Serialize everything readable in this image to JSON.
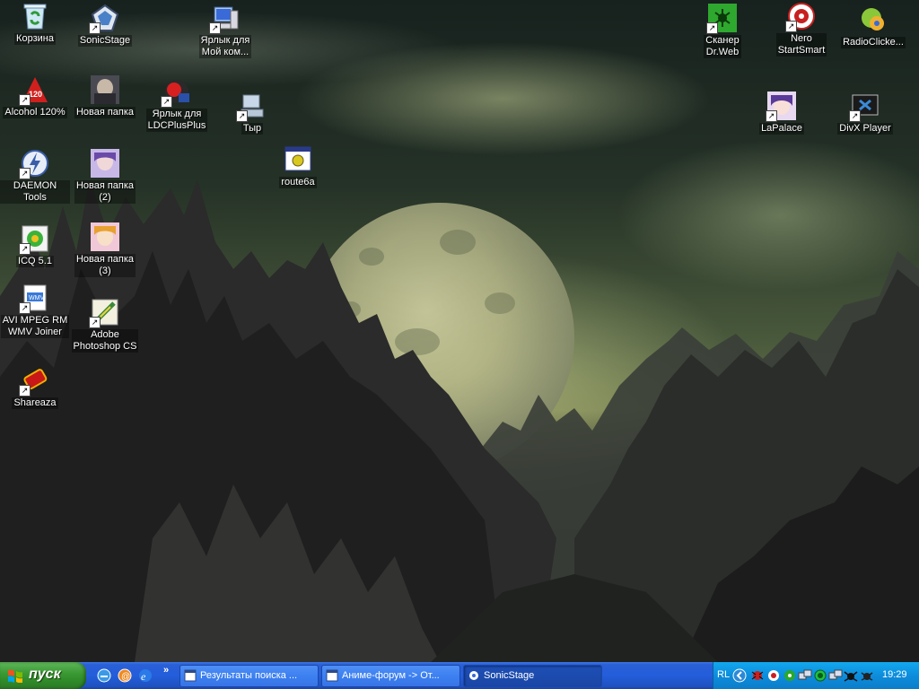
{
  "desktop": {
    "icons": [
      {
        "label": "Корзина",
        "name": "recycle-bin-icon"
      },
      {
        "label": "SonicStage",
        "name": "sonicstage-icon"
      },
      {
        "label": "Ярлык для\nМой ком...",
        "name": "my-computer-shortcut-icon"
      },
      {
        "label": "Сканер\nDr.Web",
        "name": "drweb-scanner-icon"
      },
      {
        "label": "Nero\nStartSmart",
        "name": "nero-icon"
      },
      {
        "label": "RadioClicke...",
        "name": "radioclicker-icon"
      },
      {
        "label": "Alcohol 120%",
        "name": "alcohol-icon"
      },
      {
        "label": "Новая папка",
        "name": "new-folder-icon"
      },
      {
        "label": "Ярлык для\nLDCPlusPlus",
        "name": "ldcplusplus-shortcut-icon"
      },
      {
        "label": "Тыр",
        "name": "tyr-icon"
      },
      {
        "label": "LaPalace",
        "name": "lapalace-icon"
      },
      {
        "label": "DivX Player",
        "name": "divx-player-icon"
      },
      {
        "label": "route6a",
        "name": "route6a-icon"
      },
      {
        "label": "DAEMON Tools",
        "name": "daemon-tools-icon"
      },
      {
        "label": "Новая папка\n(2)",
        "name": "new-folder-2-icon"
      },
      {
        "label": "ICQ 5.1",
        "name": "icq-icon"
      },
      {
        "label": "Новая папка\n(3)",
        "name": "new-folder-3-icon"
      },
      {
        "label": "AVI MPEG RM\nWMV Joiner",
        "name": "avi-joiner-icon"
      },
      {
        "label": "Adobe\nPhotoshop CS",
        "name": "photoshop-icon"
      },
      {
        "label": "Shareaza",
        "name": "shareaza-icon"
      }
    ]
  },
  "taskbar": {
    "start_label": "пуск",
    "quick_launch": [
      "show-desktop-icon",
      "mail-icon",
      "internet-explorer-icon"
    ],
    "overflow": "»",
    "tasks": [
      {
        "title": "Результаты поиска ...",
        "active": false
      },
      {
        "title": "Аниме-форум -> От...",
        "active": false
      },
      {
        "title": "SonicStage",
        "active": true
      }
    ],
    "language": "RL",
    "clock": "19:29",
    "tray_icons": [
      "chevron-left-icon",
      "dr-web-spider-icon",
      "nero-tray-icon",
      "green-gear-icon",
      "network-icon",
      "radio-icon",
      "network-2-icon",
      "volume-icon",
      "antivirus-icon",
      "spider-icon"
    ]
  },
  "colors": {
    "taskbar_blue": "#245edb",
    "start_green": "#3c9a35",
    "tray_blue": "#0d8ddc",
    "label_bg": "rgba(0,0,0,0.35)"
  }
}
